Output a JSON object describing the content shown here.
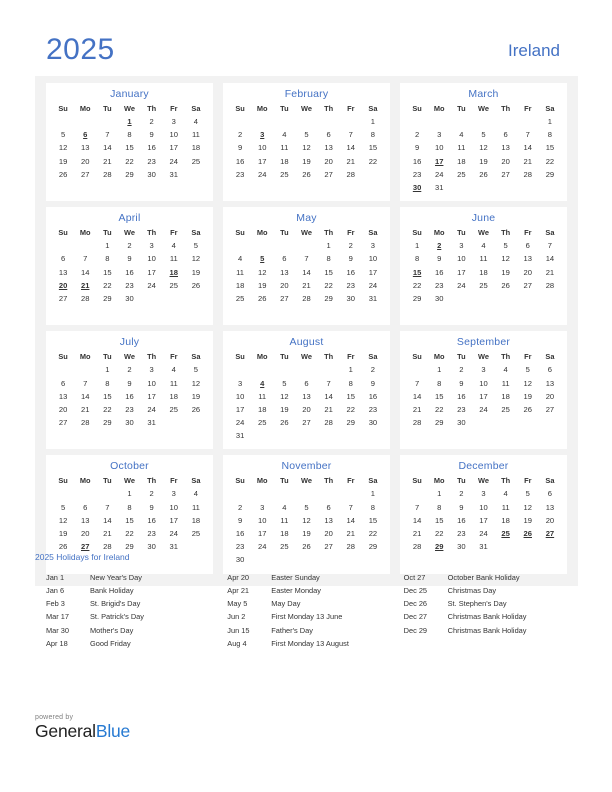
{
  "header": {
    "year": "2025",
    "country": "Ireland"
  },
  "colors": {
    "accent": "#4472C4",
    "holiday": "#D42B1E",
    "page_bg": "#FFFFFF",
    "grid_bg": "#F2F2F2",
    "card_bg": "#FFFFFF",
    "text": "#333333",
    "brand_blue": "#2579D2"
  },
  "weekday_headers": [
    "Su",
    "Mo",
    "Tu",
    "We",
    "Th",
    "Fr",
    "Sa"
  ],
  "months": [
    {
      "name": "January",
      "weeks": [
        [
          "",
          "",
          "",
          "1",
          "2",
          "3",
          "4"
        ],
        [
          "5",
          "6",
          "7",
          "8",
          "9",
          "10",
          "11"
        ],
        [
          "12",
          "13",
          "14",
          "15",
          "16",
          "17",
          "18"
        ],
        [
          "19",
          "20",
          "21",
          "22",
          "23",
          "24",
          "25"
        ],
        [
          "26",
          "27",
          "28",
          "29",
          "30",
          "31",
          ""
        ],
        [
          "",
          "",
          "",
          "",
          "",
          "",
          ""
        ]
      ],
      "holidays": [
        1,
        6
      ]
    },
    {
      "name": "February",
      "weeks": [
        [
          "",
          "",
          "",
          "",
          "",
          "",
          "1"
        ],
        [
          "2",
          "3",
          "4",
          "5",
          "6",
          "7",
          "8"
        ],
        [
          "9",
          "10",
          "11",
          "12",
          "13",
          "14",
          "15"
        ],
        [
          "16",
          "17",
          "18",
          "19",
          "20",
          "21",
          "22"
        ],
        [
          "23",
          "24",
          "25",
          "26",
          "27",
          "28",
          ""
        ],
        [
          "",
          "",
          "",
          "",
          "",
          "",
          ""
        ]
      ],
      "holidays": [
        3
      ]
    },
    {
      "name": "March",
      "weeks": [
        [
          "",
          "",
          "",
          "",
          "",
          "",
          "1"
        ],
        [
          "2",
          "3",
          "4",
          "5",
          "6",
          "7",
          "8"
        ],
        [
          "9",
          "10",
          "11",
          "12",
          "13",
          "14",
          "15"
        ],
        [
          "16",
          "17",
          "18",
          "19",
          "20",
          "21",
          "22"
        ],
        [
          "23",
          "24",
          "25",
          "26",
          "27",
          "28",
          "29"
        ],
        [
          "30",
          "31",
          "",
          "",
          "",
          "",
          ""
        ]
      ],
      "holidays": [
        17,
        30
      ]
    },
    {
      "name": "April",
      "weeks": [
        [
          "",
          "",
          "1",
          "2",
          "3",
          "4",
          "5"
        ],
        [
          "6",
          "7",
          "8",
          "9",
          "10",
          "11",
          "12"
        ],
        [
          "13",
          "14",
          "15",
          "16",
          "17",
          "18",
          "19"
        ],
        [
          "20",
          "21",
          "22",
          "23",
          "24",
          "25",
          "26"
        ],
        [
          "27",
          "28",
          "29",
          "30",
          "",
          "",
          ""
        ],
        [
          "",
          "",
          "",
          "",
          "",
          "",
          ""
        ]
      ],
      "holidays": [
        18,
        20,
        21
      ]
    },
    {
      "name": "May",
      "weeks": [
        [
          "",
          "",
          "",
          "",
          "1",
          "2",
          "3"
        ],
        [
          "4",
          "5",
          "6",
          "7",
          "8",
          "9",
          "10"
        ],
        [
          "11",
          "12",
          "13",
          "14",
          "15",
          "16",
          "17"
        ],
        [
          "18",
          "19",
          "20",
          "21",
          "22",
          "23",
          "24"
        ],
        [
          "25",
          "26",
          "27",
          "28",
          "29",
          "30",
          "31"
        ],
        [
          "",
          "",
          "",
          "",
          "",
          "",
          ""
        ]
      ],
      "holidays": [
        5
      ]
    },
    {
      "name": "June",
      "weeks": [
        [
          "1",
          "2",
          "3",
          "4",
          "5",
          "6",
          "7"
        ],
        [
          "8",
          "9",
          "10",
          "11",
          "12",
          "13",
          "14"
        ],
        [
          "15",
          "16",
          "17",
          "18",
          "19",
          "20",
          "21"
        ],
        [
          "22",
          "23",
          "24",
          "25",
          "26",
          "27",
          "28"
        ],
        [
          "29",
          "30",
          "",
          "",
          "",
          "",
          ""
        ],
        [
          "",
          "",
          "",
          "",
          "",
          "",
          ""
        ]
      ],
      "holidays": [
        2,
        15
      ]
    },
    {
      "name": "July",
      "weeks": [
        [
          "",
          "",
          "1",
          "2",
          "3",
          "4",
          "5"
        ],
        [
          "6",
          "7",
          "8",
          "9",
          "10",
          "11",
          "12"
        ],
        [
          "13",
          "14",
          "15",
          "16",
          "17",
          "18",
          "19"
        ],
        [
          "20",
          "21",
          "22",
          "23",
          "24",
          "25",
          "26"
        ],
        [
          "27",
          "28",
          "29",
          "30",
          "31",
          "",
          ""
        ],
        [
          "",
          "",
          "",
          "",
          "",
          "",
          ""
        ]
      ],
      "holidays": []
    },
    {
      "name": "August",
      "weeks": [
        [
          "",
          "",
          "",
          "",
          "",
          "1",
          "2"
        ],
        [
          "3",
          "4",
          "5",
          "6",
          "7",
          "8",
          "9"
        ],
        [
          "10",
          "11",
          "12",
          "13",
          "14",
          "15",
          "16"
        ],
        [
          "17",
          "18",
          "19",
          "20",
          "21",
          "22",
          "23"
        ],
        [
          "24",
          "25",
          "26",
          "27",
          "28",
          "29",
          "30"
        ],
        [
          "31",
          "",
          "",
          "",
          "",
          "",
          ""
        ]
      ],
      "holidays": [
        4
      ]
    },
    {
      "name": "September",
      "weeks": [
        [
          "",
          "1",
          "2",
          "3",
          "4",
          "5",
          "6"
        ],
        [
          "7",
          "8",
          "9",
          "10",
          "11",
          "12",
          "13"
        ],
        [
          "14",
          "15",
          "16",
          "17",
          "18",
          "19",
          "20"
        ],
        [
          "21",
          "22",
          "23",
          "24",
          "25",
          "26",
          "27"
        ],
        [
          "28",
          "29",
          "30",
          "",
          "",
          "",
          ""
        ],
        [
          "",
          "",
          "",
          "",
          "",
          "",
          ""
        ]
      ],
      "holidays": []
    },
    {
      "name": "October",
      "weeks": [
        [
          "",
          "",
          "",
          "1",
          "2",
          "3",
          "4"
        ],
        [
          "5",
          "6",
          "7",
          "8",
          "9",
          "10",
          "11"
        ],
        [
          "12",
          "13",
          "14",
          "15",
          "16",
          "17",
          "18"
        ],
        [
          "19",
          "20",
          "21",
          "22",
          "23",
          "24",
          "25"
        ],
        [
          "26",
          "27",
          "28",
          "29",
          "30",
          "31",
          ""
        ],
        [
          "",
          "",
          "",
          "",
          "",
          "",
          ""
        ]
      ],
      "holidays": [
        27
      ]
    },
    {
      "name": "November",
      "weeks": [
        [
          "",
          "",
          "",
          "",
          "",
          "",
          "1"
        ],
        [
          "2",
          "3",
          "4",
          "5",
          "6",
          "7",
          "8"
        ],
        [
          "9",
          "10",
          "11",
          "12",
          "13",
          "14",
          "15"
        ],
        [
          "16",
          "17",
          "18",
          "19",
          "20",
          "21",
          "22"
        ],
        [
          "23",
          "24",
          "25",
          "26",
          "27",
          "28",
          "29"
        ],
        [
          "30",
          "",
          "",
          "",
          "",
          "",
          ""
        ]
      ],
      "holidays": []
    },
    {
      "name": "December",
      "weeks": [
        [
          "",
          "1",
          "2",
          "3",
          "4",
          "5",
          "6"
        ],
        [
          "7",
          "8",
          "9",
          "10",
          "11",
          "12",
          "13"
        ],
        [
          "14",
          "15",
          "16",
          "17",
          "18",
          "19",
          "20"
        ],
        [
          "21",
          "22",
          "23",
          "24",
          "25",
          "26",
          "27"
        ],
        [
          "28",
          "29",
          "30",
          "31",
          "",
          "",
          ""
        ],
        [
          "",
          "",
          "",
          "",
          "",
          "",
          ""
        ]
      ],
      "holidays": [
        25,
        26,
        27,
        29
      ]
    }
  ],
  "holidays_section": {
    "title": "2025 Holidays for Ireland",
    "columns": [
      [
        {
          "date": "Jan 1",
          "name": "New Year's Day"
        },
        {
          "date": "Jan 6",
          "name": "Bank Holiday"
        },
        {
          "date": "Feb 3",
          "name": "St. Brigid's Day"
        },
        {
          "date": "Mar 17",
          "name": "St. Patrick's Day"
        },
        {
          "date": "Mar 30",
          "name": "Mother's Day"
        },
        {
          "date": "Apr 18",
          "name": "Good Friday"
        }
      ],
      [
        {
          "date": "Apr 20",
          "name": "Easter Sunday"
        },
        {
          "date": "Apr 21",
          "name": "Easter Monday"
        },
        {
          "date": "May 5",
          "name": "May Day"
        },
        {
          "date": "Jun 2",
          "name": "First Monday 13 June"
        },
        {
          "date": "Jun 15",
          "name": "Father's Day"
        },
        {
          "date": "Aug 4",
          "name": "First Monday 13 August"
        }
      ],
      [
        {
          "date": "Oct 27",
          "name": "October Bank Holiday"
        },
        {
          "date": "Dec 25",
          "name": "Christmas Day"
        },
        {
          "date": "Dec 26",
          "name": "St. Stephen's Day"
        },
        {
          "date": "Dec 27",
          "name": "Christmas Bank Holiday"
        },
        {
          "date": "Dec 29",
          "name": "Christmas Bank Holiday"
        }
      ]
    ]
  },
  "footer": {
    "powered_by": "powered by",
    "brand_first": "General",
    "brand_second": "Blue"
  }
}
